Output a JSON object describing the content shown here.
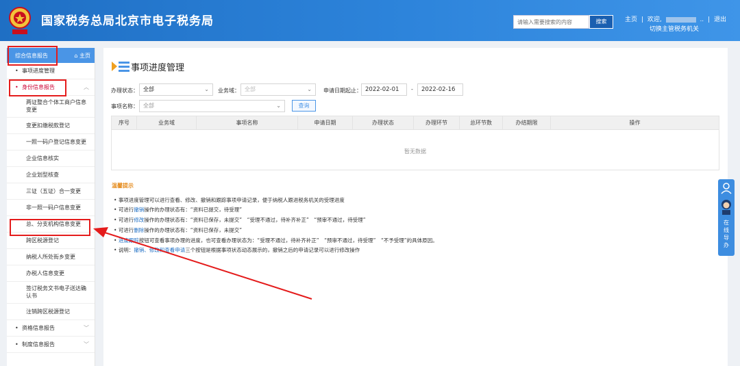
{
  "header": {
    "site_title": "国家税务总局北京市电子税务局",
    "logo_text": "中国税务",
    "search_placeholder": "请输入需要搜索的内容",
    "search_button": "搜索",
    "home_link": "主页",
    "welcome": "欢迎,",
    "user_suffix": "..",
    "logout_link": "退出",
    "switch_authority": "切换主管税务机关",
    "separator": "|"
  },
  "sidebar": {
    "title": "综合信息报告",
    "home_link": "主页",
    "items": [
      {
        "label": "事项进度管理"
      },
      {
        "label": "身份信息报告"
      }
    ],
    "sub_items": [
      "两证整合个体工商户信息变更",
      "变更扣缴税款登记",
      "一照一码户登记信息变更",
      "企业信息核实",
      "企业划型核查",
      "三证（五证）合一变更",
      "非一照一码户信息变更",
      "总、分支机构信息变更",
      "跨区税源登记",
      "纳税人所处街乡变更",
      "办税人信息变更",
      "签订税务文书电子送达确认书",
      "注销跨区税源登记"
    ],
    "bottom_items": [
      {
        "label": "资格信息报告"
      },
      {
        "label": "制度信息报告"
      }
    ]
  },
  "main": {
    "page_title": "事项进度管理",
    "filters": {
      "status_label": "办理状态：",
      "status_value": "全部",
      "domain_label": "业务域：",
      "domain_value": "全部",
      "date_label": "申请日期起止：",
      "date_start": "2022-02-01",
      "date_dash": "-",
      "date_end": "2022-02-16",
      "item_label": "事项名称：",
      "item_value": "全部",
      "query_button": "查询"
    },
    "table": {
      "columns": [
        "序号",
        "业务域",
        "事项名称",
        "申请日期",
        "办理状态",
        "办理环节",
        "总环节数",
        "办结期限",
        "操作"
      ],
      "empty_text": "暂无数据"
    },
    "tips": {
      "title": "温馨提示",
      "lines": [
        {
          "pre": "事项进度管理可以进行查看、修改、撤销和跟踪事项申请记录，便于纳税人跟进税务机关的受理进度",
          "key": "",
          "post": ""
        },
        {
          "pre": "可进行",
          "key": "撤销",
          "post": "操作的办理状态有：“资料已提交，待受理”"
        },
        {
          "pre": "可进行",
          "key": "修改",
          "post": "操作的办理状态有：“资料已保存，未提交”　“受理不通过，待补齐补正”　“预审不通过，待受理”"
        },
        {
          "pre": "可进行",
          "key": "删除",
          "post": "操作的办理状态有：“资料已保存，未提交”"
        },
        {
          "pre": "",
          "key": "进度跟踪",
          "post": "按钮可查看事项办理的进度，也可查看办理状态为：“受理不通过，待补齐补正”　“预审不通过，待受理”　“不予受理”的具体原因。"
        },
        {
          "pre": "说明：",
          "key": "撤销、修改和查看申请",
          "post": "三个按钮是根据事项状态动态展示的，撤销之后的申请记录可以进行修改操作"
        }
      ]
    }
  },
  "float_widget": {
    "label": "在线导办"
  },
  "colors": {
    "header_blue": "#2d84db",
    "sidebar_active": "#4a95e6",
    "annotation_red": "#e41b1b",
    "tips_orange": "#e58a1a"
  },
  "icons": {
    "bullet": "•",
    "chevron_up": "︿",
    "chevron_down": "﹀",
    "select_arrow": "⌄",
    "home": "⌂"
  }
}
